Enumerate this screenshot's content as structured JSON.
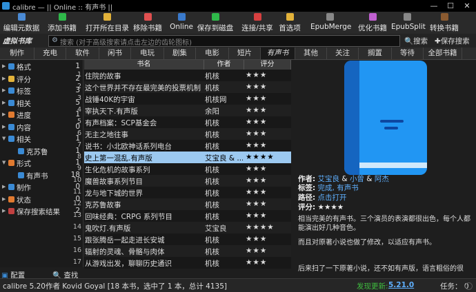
{
  "window": {
    "title": "calibre — || Online :: 有声书 ||",
    "minimize": "—",
    "maximize": "☐",
    "close": "✕"
  },
  "toolbar": [
    {
      "label": "编辑元数据",
      "icon": "edit-metadata-icon",
      "color": "#4a8ad4"
    },
    {
      "label": "添加书籍",
      "icon": "add-book-icon",
      "color": "#2fb84a"
    },
    {
      "label": "打开所在目录",
      "icon": "folder-icon",
      "color": "#e2b23a"
    },
    {
      "label": "移除书籍",
      "icon": "remove-book-icon",
      "color": "#e05050"
    },
    {
      "label": "Online",
      "icon": "online-icon",
      "color": "#3a7acc"
    },
    {
      "label": "保存到磁盘",
      "icon": "save-icon",
      "color": "#2fb84a"
    },
    {
      "label": "连接/共享",
      "icon": "connect-icon",
      "color": "#d64040"
    },
    {
      "label": "首选项",
      "icon": "preferences-icon",
      "color": "#e2b23a"
    },
    {
      "label": "EpubMerge",
      "icon": "epubmerge-icon",
      "color": "#888888"
    },
    {
      "label": "优化书籍",
      "icon": "polish-icon",
      "color": "#c060d0"
    },
    {
      "label": "EpubSplit",
      "icon": "epubsplit-icon",
      "color": "#888888"
    },
    {
      "label": "转换书籍",
      "icon": "convert-icon",
      "color": "#8a5a30"
    }
  ],
  "search": {
    "virtual_library": "虚拟书库",
    "placeholder": "搜索 (对于高级搜索请点击左边的齿轮图标)",
    "search_button": "搜索",
    "save_search_button": "保存搜索"
  },
  "vl_tabs": [
    "制作",
    "充电",
    "软件",
    "闲书",
    "电玩",
    "剧集",
    "电影",
    "短片",
    "有声书",
    "其他",
    "关注",
    "搁置",
    "等待",
    "全部书籍"
  ],
  "vl_tab_active": "有声书",
  "tag_browser": [
    {
      "label": "格式",
      "count": "1",
      "icon_color": "#3a8ad4",
      "expanded": false
    },
    {
      "label": "评分",
      "count": "2",
      "icon_color": "#e2b23a",
      "expanded": false
    },
    {
      "label": "标签",
      "count": "3",
      "icon_color": "#3a8ad4",
      "expanded": false
    },
    {
      "label": "相关",
      "count": "5",
      "icon_color": "#3a8ad4",
      "expanded": false
    },
    {
      "label": "进度",
      "count": "1",
      "icon_color": "#e07a30",
      "expanded": false
    },
    {
      "label": "内容",
      "count": "0",
      "icon_color": "#3a8ad4",
      "expanded": false
    },
    {
      "label": "相关",
      "count": "1",
      "icon_color": "#3a8ad4",
      "expanded": true
    },
    {
      "label": "克苏鲁",
      "count": "1",
      "icon_color": "#3a8ad4",
      "child": true
    },
    {
      "label": "形式",
      "count": "1",
      "icon_color": "#e07a30",
      "expanded": true
    },
    {
      "label": "有声书",
      "count": "18",
      "icon_color": "#3a8ad4",
      "child": true
    },
    {
      "label": "制作",
      "count": "0",
      "icon_color": "#3a8ad4",
      "expanded": false
    },
    {
      "label": "状态",
      "count": "0",
      "icon_color": "#e07a30",
      "expanded": false
    },
    {
      "label": "保存搜索结果",
      "count": "2",
      "icon_color": "#c04040",
      "expanded": false
    }
  ],
  "tag_footer": {
    "configure": "配置",
    "find": "查找"
  },
  "book_table": {
    "headers": {
      "title": "书名",
      "author": "作者",
      "rating": "评分"
    },
    "rows": [
      {
        "n": "1",
        "title": "住院的故事",
        "author": "机核",
        "rating": "★★★"
      },
      {
        "n": "2",
        "title": "这个世界并不存在最完美的投票机制",
        "author": "机核",
        "rating": "★★★"
      },
      {
        "n": "3",
        "title": "战锤40K的宇宙",
        "author": "机核网",
        "rating": "★★★"
      },
      {
        "n": "4",
        "title": "宰执天下.有声版",
        "author": "余阳",
        "rating": "★★★"
      },
      {
        "n": "5",
        "title": "有声档案：SCP基金会",
        "author": "机核",
        "rating": "★★★"
      },
      {
        "n": "6",
        "title": "无主之地往事",
        "author": "机核",
        "rating": "★★★"
      },
      {
        "n": "7",
        "title": "说书：小北欧神话系列电台",
        "author": "机核",
        "rating": "★★★"
      },
      {
        "n": "8",
        "title": "史上第一混乱.有声版",
        "author": "艾宝良 & ...",
        "rating": "★★★★",
        "selected": true
      },
      {
        "n": "9",
        "title": "生化危机的故事系列",
        "author": "机核",
        "rating": "★★★"
      },
      {
        "n": "10",
        "title": "魔兽故事系列节目",
        "author": "机核",
        "rating": "★★★"
      },
      {
        "n": "11",
        "title": "龙与地下城的世界",
        "author": "机核",
        "rating": "★★★"
      },
      {
        "n": "12",
        "title": "克苏鲁故事",
        "author": "机核",
        "rating": "★★★"
      },
      {
        "n": "13",
        "title": "回味经典：CRPG 系列节目",
        "author": "机核",
        "rating": "★★★"
      },
      {
        "n": "14",
        "title": "鬼吹灯.有声版",
        "author": "艾宝良",
        "rating": "★★★★"
      },
      {
        "n": "15",
        "title": "跟张腾岳一起走进长安城",
        "author": "机核",
        "rating": "★★★"
      },
      {
        "n": "16",
        "title": "辐射的灵魂、骨骼与肉体",
        "author": "机核",
        "rating": "★★★"
      },
      {
        "n": "17",
        "title": "从游戏出发，聊聊历史通识",
        "author": "机核",
        "rating": "★★★"
      }
    ]
  },
  "details": {
    "author_label": "作者:",
    "authors": [
      "艾宝良",
      "小曾",
      "阿杰"
    ],
    "author_sep": "&",
    "tags_label": "标签:",
    "tags": "完成, 有声书",
    "path_label": "路径:",
    "path": "点击打开",
    "rating_label": "评分:",
    "rating": "★★★★",
    "comments": [
      "相当完美的有声书。三个演员的表演都很出色，每个人都能演出好几种音色。",
      "而且对原著小说也做了修改，以适应有声书。",
      "后来扫了一下原著小说，还不如有声版，语言粗俗的很"
    ]
  },
  "status": {
    "left": "calibre 5.20作者 Kovid Goyal   [18 本书，选中了 1 本，总计 4135]",
    "update_label": "发现更新:",
    "update_version": "5.21.0",
    "jobs": "任务： 0"
  }
}
